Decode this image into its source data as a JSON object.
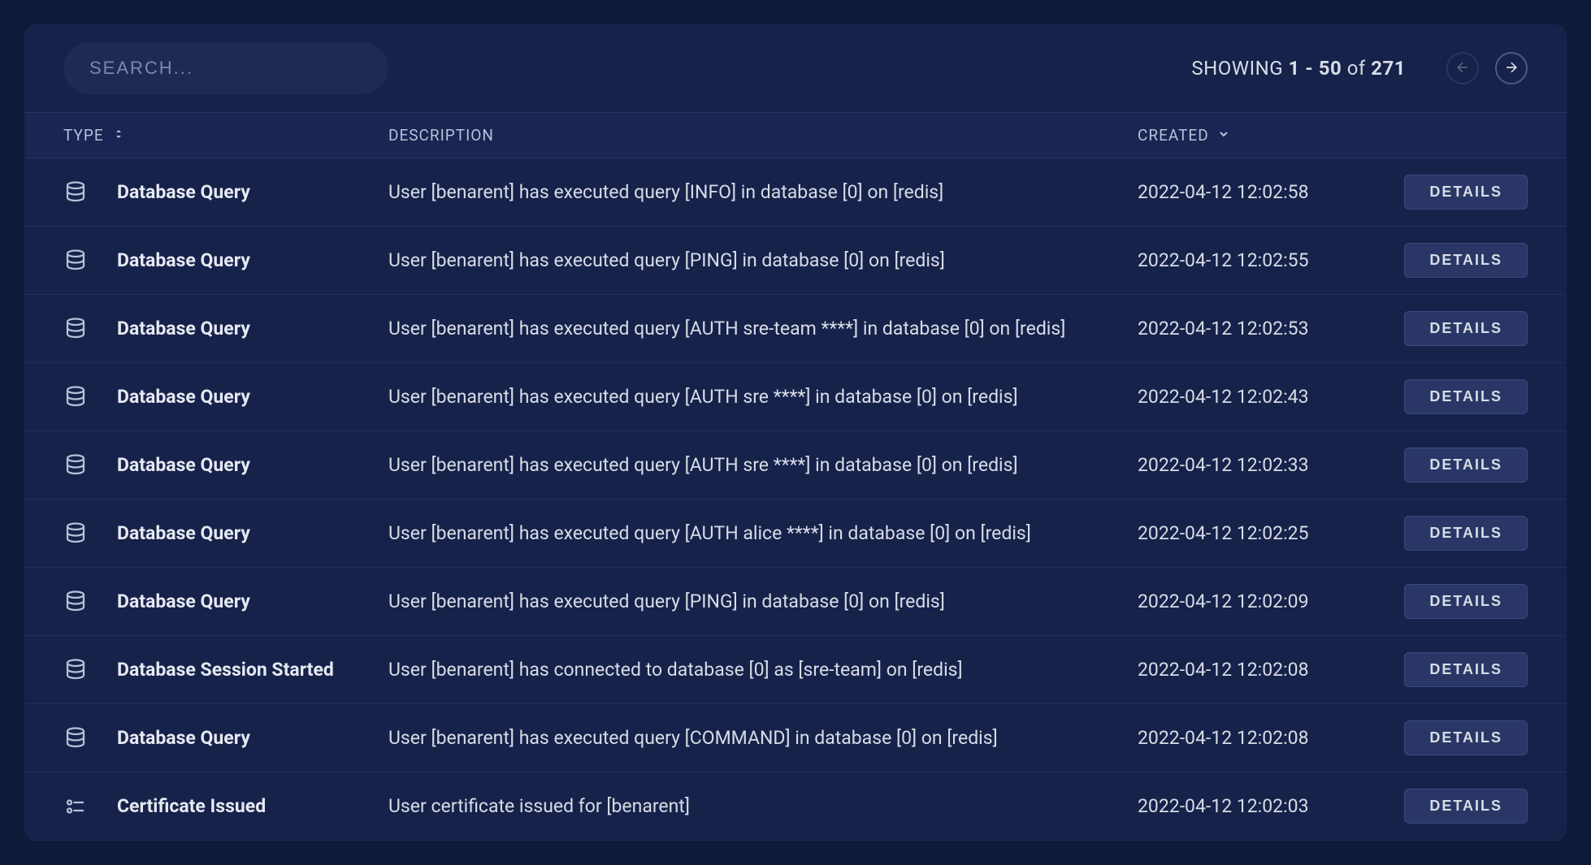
{
  "search": {
    "placeholder": "SEARCH..."
  },
  "pagination": {
    "label_prefix": "SHOWING ",
    "from": "1",
    "dash": " - ",
    "to": "50",
    "of_label": " of ",
    "total": "271"
  },
  "columns": {
    "type": "TYPE",
    "description": "DESCRIPTION",
    "created": "CREATED"
  },
  "details_label": "DETAILS",
  "rows": [
    {
      "icon": "database",
      "type": "Database Query",
      "description": "User [benarent] has executed query [INFO] in database [0] on [redis]",
      "created": "2022-04-12 12:02:58"
    },
    {
      "icon": "database",
      "type": "Database Query",
      "description": "User [benarent] has executed query [PING] in database [0] on [redis]",
      "created": "2022-04-12 12:02:55"
    },
    {
      "icon": "database",
      "type": "Database Query",
      "description": "User [benarent] has executed query [AUTH sre-team ****] in database [0] on [redis]",
      "created": "2022-04-12 12:02:53"
    },
    {
      "icon": "database",
      "type": "Database Query",
      "description": "User [benarent] has executed query [AUTH sre ****] in database [0] on [redis]",
      "created": "2022-04-12 12:02:43"
    },
    {
      "icon": "database",
      "type": "Database Query",
      "description": "User [benarent] has executed query [AUTH sre ****] in database [0] on [redis]",
      "created": "2022-04-12 12:02:33"
    },
    {
      "icon": "database",
      "type": "Database Query",
      "description": "User [benarent] has executed query [AUTH alice ****] in database [0] on [redis]",
      "created": "2022-04-12 12:02:25"
    },
    {
      "icon": "database",
      "type": "Database Query",
      "description": "User [benarent] has executed query [PING] in database [0] on [redis]",
      "created": "2022-04-12 12:02:09"
    },
    {
      "icon": "database",
      "type": "Database Session Started",
      "description": "User [benarent] has connected to database [0] as [sre-team] on [redis]",
      "created": "2022-04-12 12:02:08"
    },
    {
      "icon": "database",
      "type": "Database Query",
      "description": "User [benarent] has executed query [COMMAND] in database [0] on [redis]",
      "created": "2022-04-12 12:02:08"
    },
    {
      "icon": "certificate",
      "type": "Certificate Issued",
      "description": "User certificate issued for [benarent]",
      "created": "2022-04-12 12:02:03"
    }
  ]
}
